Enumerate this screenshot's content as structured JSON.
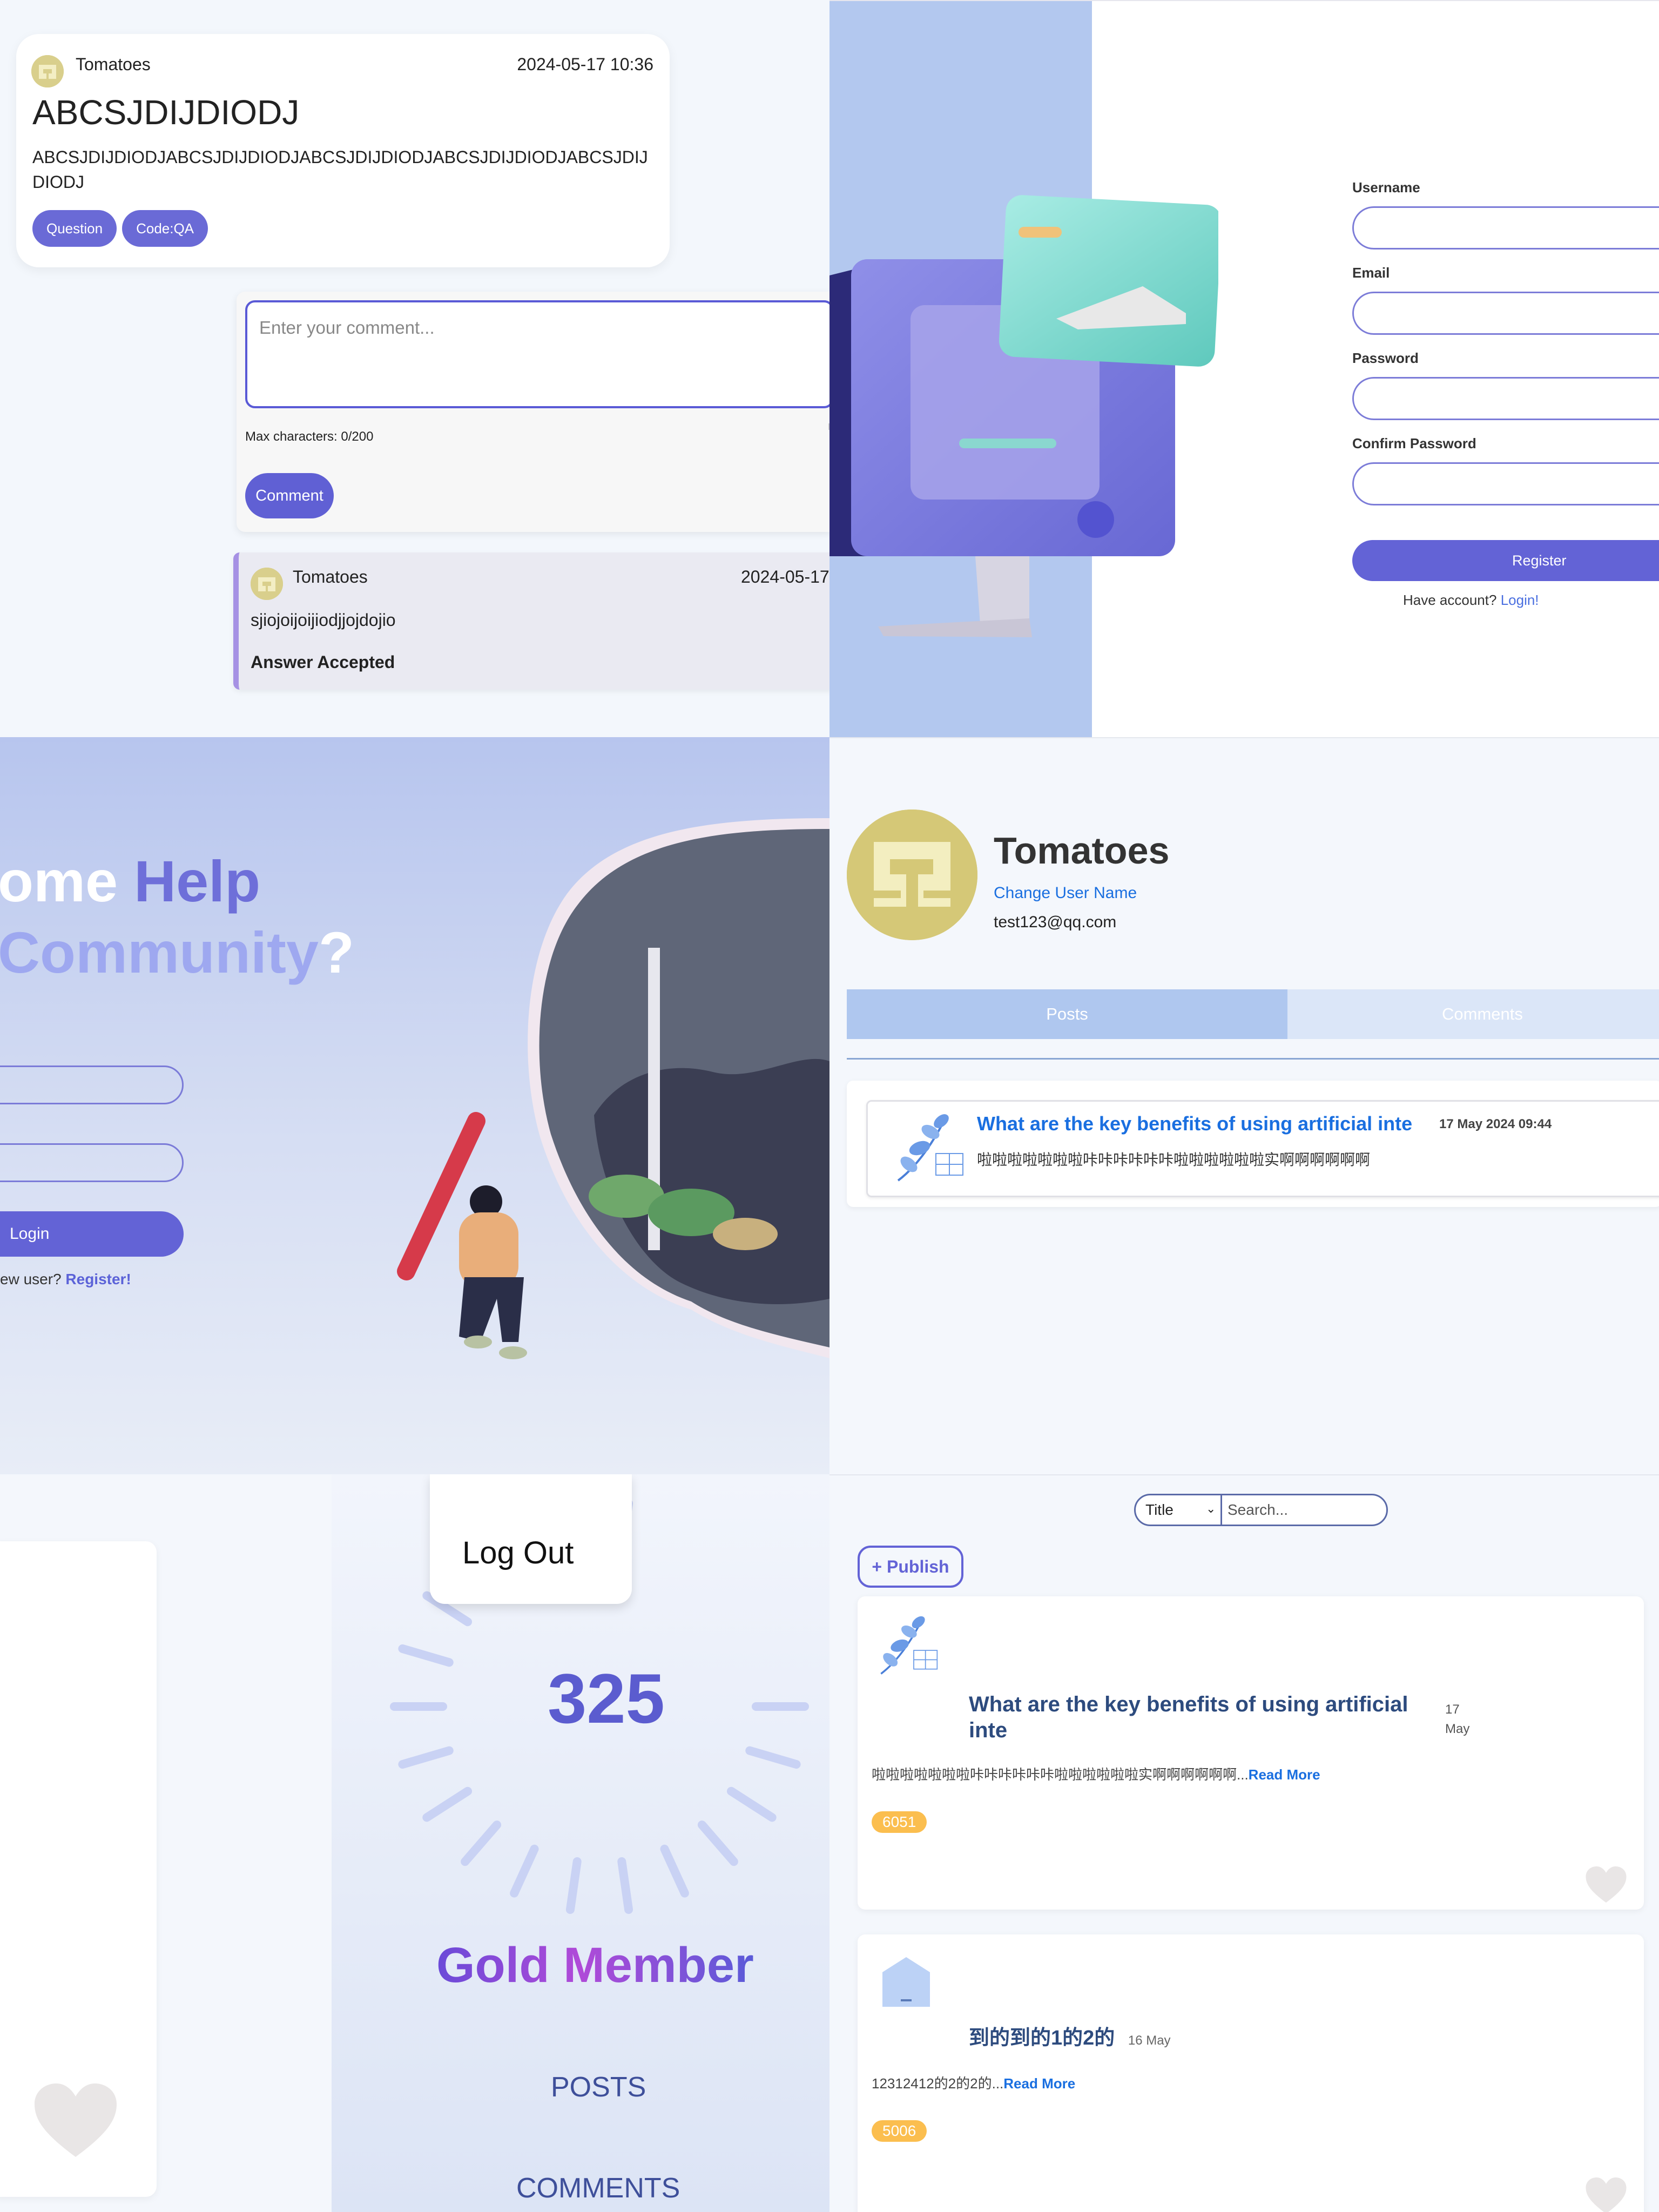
{
  "question": {
    "author": "Tomatoes",
    "datetime": "2024-05-17 10:36",
    "title": "ABCSJDIJDIODJ",
    "body": "ABCSJDIJDIODJABCSJDIJDIODJABCSJDIJDIODJABCSJDIJDIODJABCSJDIJDIODJ",
    "tags": [
      "Question",
      "Code:QA"
    ]
  },
  "comment_form": {
    "placeholder": "Enter your comment...",
    "counter": "Max characters: 0/200",
    "submit_label": "Comment"
  },
  "answer": {
    "author": "Tomatoes",
    "date": "2024-05-17",
    "text": "sjiojoijoijiodjjojdojio",
    "status": "Answer Accepted"
  },
  "register": {
    "username_label": "Username",
    "email_label": "Email",
    "password_label": "Password",
    "confirm_label": "Confirm Password",
    "submit_label": "Register",
    "have_account": "Have account?",
    "login_link": "Login!"
  },
  "login": {
    "headline_part1": "ome ",
    "headline_part2": "Help",
    "headline_part3": "Community",
    "headline_part4": "?",
    "submit_label": "Login",
    "new_user": "ew user?",
    "register_link": "Register!"
  },
  "profile": {
    "name": "Tomatoes",
    "change_name_link": "Change User Name",
    "email": "test123@qq.com",
    "tabs": [
      "Posts",
      "Comments"
    ],
    "post": {
      "title": "What are the key benefits of using artificial inte",
      "date": "17 May 2024 09:44",
      "excerpt": "啦啦啦啦啦啦啦咔咔咔咔咔咔啦啦啦啦啦啦实啊啊啊啊啊啊"
    }
  },
  "member": {
    "logout_label": "Log Out",
    "points": "325",
    "level": "Gold Member",
    "posts_label": "POSTS",
    "comments_label": "COMMENTS"
  },
  "feed": {
    "filter_selected": "Title",
    "search_placeholder": "Search...",
    "publish_label": "+ Publish",
    "posts": [
      {
        "title": "What are the key benefits of using artificial inte",
        "date_day": "17",
        "date_month": "May",
        "excerpt": "啦啦啦啦啦啦啦咔咔咔咔咔咔啦啦啦啦啦啦实啊啊啊啊啊啊...",
        "read_more": "Read More",
        "count": "6051"
      },
      {
        "title": "到的到的1的2的",
        "date": "16 May",
        "excerpt": "12312412的2的2的...",
        "read_more": "Read More",
        "count": "5006"
      }
    ]
  },
  "colors": {
    "accent": "#6363d6",
    "link": "#1a6fe0",
    "badge": "#fbbe4f",
    "tab_active": "#b3caf0"
  }
}
